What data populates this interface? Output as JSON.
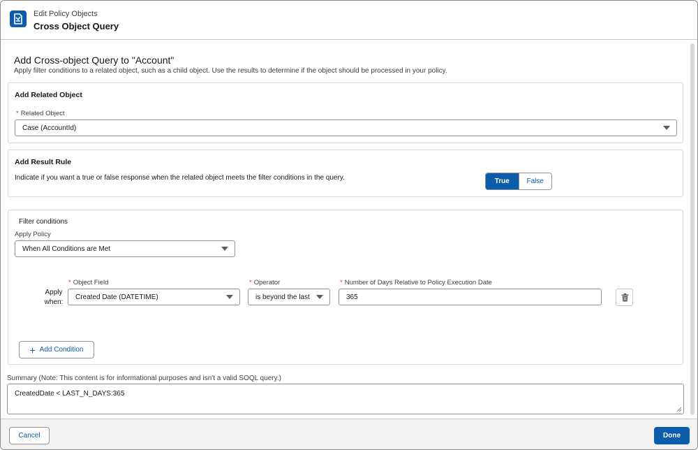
{
  "header": {
    "app_icon": "policy-icon",
    "subtitle": "Edit Policy Objects",
    "title": "Cross Object Query"
  },
  "main": {
    "title": "Add Cross-object Query to \"Account\"",
    "description": "Apply filter conditions to a related object, such as a child object. Use the results to determine if the object should be processed in your policy."
  },
  "related_object": {
    "section_title": "Add Related Object",
    "required_marker": "*",
    "label": "Related Object",
    "value": "Case (AccountId)"
  },
  "result_rule": {
    "section_title": "Add Result Rule",
    "description": "Indicate if you want a true or false response when the related object meets the filter conditions in the query.",
    "true_label": "True",
    "false_label": "False",
    "selected": "True"
  },
  "filter": {
    "section_title": "Filter conditions",
    "apply_policy_label": "Apply Policy",
    "apply_policy_value": "When All Conditions are Met",
    "apply_when_label": "Apply when:",
    "object_field_label": "Object Field",
    "object_field_value": "Created Date (DATETIME)",
    "operator_label": "Operator",
    "operator_value": "is beyond the last",
    "days_label": "Number of Days Relative to Policy Execution Date",
    "days_value": "365",
    "delete_icon": "trash-icon",
    "add_condition_label": "Add Condition"
  },
  "summary": {
    "label": "Summary (Note: This content is for informational purposes and isn't a valid SOQL query.)",
    "value": "CreatedDate < LAST_N_DAYS:365"
  },
  "footer": {
    "cancel_label": "Cancel",
    "done_label": "Done"
  },
  "colors": {
    "brand": "#0b5cab",
    "required": "#c23934",
    "footer_bg": "#f3f3f3"
  }
}
